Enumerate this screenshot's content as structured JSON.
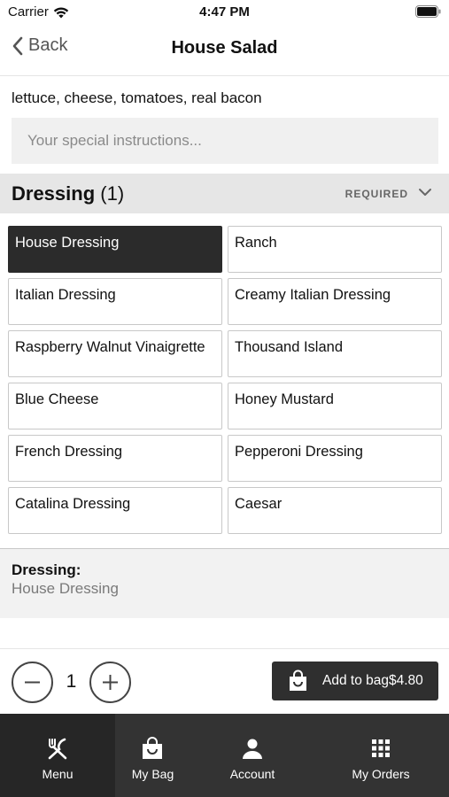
{
  "status_bar": {
    "carrier": "Carrier",
    "time": "4:47 PM",
    "wifi_icon": "wifi-icon",
    "battery_icon": "battery-icon"
  },
  "nav": {
    "back_label": "Back",
    "title": "House Salad"
  },
  "item": {
    "description": "lettuce, cheese, tomatoes, real bacon",
    "instructions_placeholder": "Your special instructions...",
    "instructions_value": ""
  },
  "section": {
    "title": "Dressing",
    "count": "(1)",
    "required_label": "REQUIRED"
  },
  "options": [
    {
      "label": "House Dressing",
      "selected": true
    },
    {
      "label": "Ranch",
      "selected": false
    },
    {
      "label": "Italian Dressing",
      "selected": false
    },
    {
      "label": "Creamy Italian Dressing",
      "selected": false
    },
    {
      "label": "Raspberry Walnut Vinaigrette",
      "selected": false
    },
    {
      "label": "Thousand Island",
      "selected": false
    },
    {
      "label": "Blue Cheese",
      "selected": false
    },
    {
      "label": "Honey Mustard",
      "selected": false
    },
    {
      "label": "French Dressing",
      "selected": false
    },
    {
      "label": "Pepperoni Dressing",
      "selected": false
    },
    {
      "label": "Catalina Dressing",
      "selected": false
    },
    {
      "label": "Caesar",
      "selected": false
    }
  ],
  "summary": {
    "label": "Dressing:",
    "value": "House Dressing"
  },
  "cart": {
    "quantity": "1",
    "add_label": "Add to bag$4.80"
  },
  "tabs": [
    {
      "label": "Menu",
      "icon": "fork-knife-icon",
      "active": true
    },
    {
      "label": "My Bag",
      "icon": "shopping-bag-icon",
      "active": false
    },
    {
      "label": "Account",
      "icon": "person-icon",
      "active": false
    },
    {
      "label": "My Orders",
      "icon": "grid-icon",
      "active": false
    }
  ],
  "colors": {
    "selected_tile": "#2b2b2b",
    "tab_bar": "#333333",
    "active_tab": "#262626",
    "section_header": "#e6e6e6"
  }
}
